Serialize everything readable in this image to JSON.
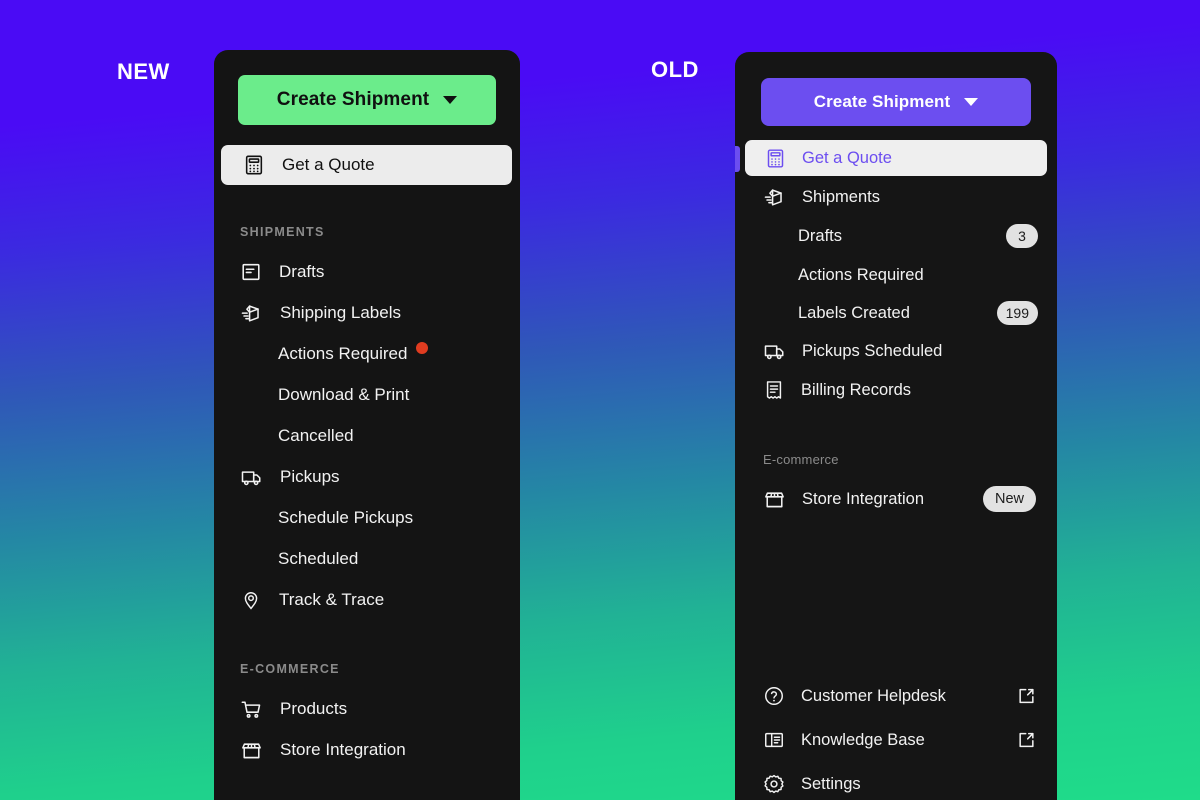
{
  "compare": {
    "new_label": "NEW",
    "old_label": "OLD"
  },
  "colors": {
    "background_top": "#4a0bf5",
    "background_bottom": "#1fdc8a",
    "panel_bg": "#141414",
    "new_cta_bg": "#6bec8b",
    "new_cta_text": "#101010",
    "old_cta_bg": "#6c4ef0",
    "old_cta_text": "#ffffff",
    "active_pill_bg": "#ececec",
    "old_active_text": "#6c4ef0",
    "alert_dot": "#e03c20",
    "badge_bg": "#e2e2e2",
    "section_head": "#8b8b8b"
  },
  "new_panel": {
    "cta": {
      "label": "Create Shipment",
      "icon": "chevron-down-icon"
    },
    "active_item": {
      "label": "Get a Quote",
      "icon": "calculator-icon"
    },
    "sections": [
      {
        "heading": "SHIPMENTS",
        "items": [
          {
            "label": "Drafts",
            "icon": "document-lines-icon",
            "sub": false
          },
          {
            "label": "Shipping Labels",
            "icon": "box-motion-icon",
            "sub": false
          },
          {
            "label": "Actions Required",
            "icon": "",
            "sub": true,
            "dot": true
          },
          {
            "label": "Download & Print",
            "icon": "",
            "sub": true
          },
          {
            "label": "Cancelled",
            "icon": "",
            "sub": true
          },
          {
            "label": "Pickups",
            "icon": "truck-icon",
            "sub": false
          },
          {
            "label": "Schedule Pickups",
            "icon": "",
            "sub": true
          },
          {
            "label": "Scheduled",
            "icon": "",
            "sub": true
          },
          {
            "label": "Track & Trace",
            "icon": "map-pin-icon",
            "sub": false
          }
        ]
      },
      {
        "heading": "E-COMMERCE",
        "items": [
          {
            "label": "Products",
            "icon": "cart-icon",
            "sub": false
          },
          {
            "label": "Store Integration",
            "icon": "storefront-icon",
            "sub": false
          }
        ]
      }
    ]
  },
  "old_panel": {
    "cta": {
      "label": "Create Shipment",
      "icon": "chevron-down-icon"
    },
    "active_item": {
      "label": "Get a Quote",
      "icon": "calculator-icon"
    },
    "sections": [
      {
        "heading": "",
        "items": [
          {
            "label": "Shipments",
            "icon": "box-motion-icon",
            "sub": false
          },
          {
            "label": "Drafts",
            "icon": "",
            "sub": true,
            "badge": "3"
          },
          {
            "label": "Actions Required",
            "icon": "",
            "sub": true
          },
          {
            "label": "Labels Created",
            "icon": "",
            "sub": true,
            "badge": "199"
          },
          {
            "label": "Pickups Scheduled",
            "icon": "truck-icon",
            "sub": false
          },
          {
            "label": "Billing Records",
            "icon": "receipt-icon",
            "sub": false
          }
        ]
      },
      {
        "heading": "E-commerce",
        "items": [
          {
            "label": "Store Integration",
            "icon": "storefront-icon",
            "sub": false,
            "new_badge": "New"
          }
        ]
      }
    ],
    "footer_items": [
      {
        "label": "Customer Helpdesk",
        "icon": "question-circle-icon",
        "external": true
      },
      {
        "label": "Knowledge Base",
        "icon": "book-panel-icon",
        "external": true
      },
      {
        "label": "Settings",
        "icon": "gear-icon",
        "external": false
      }
    ]
  }
}
